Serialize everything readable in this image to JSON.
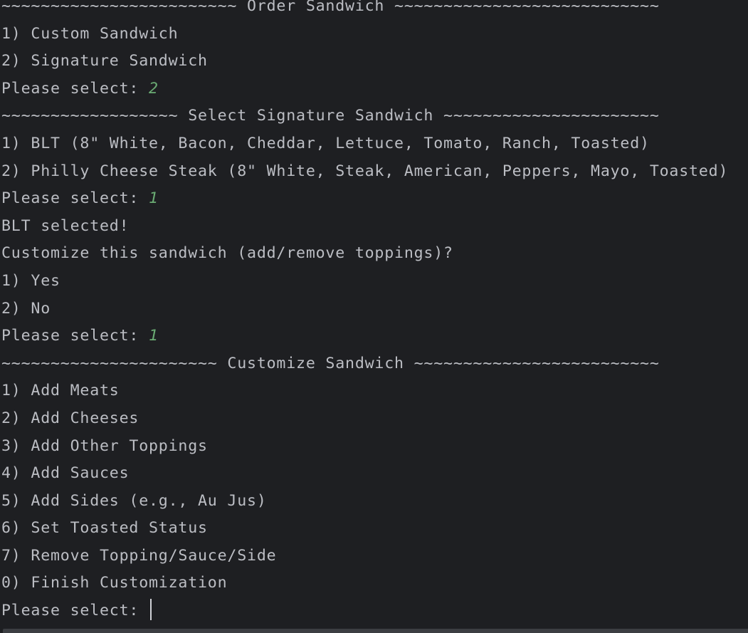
{
  "console": {
    "lines": [
      {
        "text": "~~~~~~~~~~~~~~~~~~~~~~~~ Order Sandwich ~~~~~~~~~~~~~~~~~~~~~~~~~~~",
        "input": null
      },
      {
        "text": "1) Custom Sandwich",
        "input": null
      },
      {
        "text": "2) Signature Sandwich",
        "input": null
      },
      {
        "text": "Please select: ",
        "input": "2"
      },
      {
        "text": "~~~~~~~~~~~~~~~~~~ Select Signature Sandwich ~~~~~~~~~~~~~~~~~~~~~~",
        "input": null
      },
      {
        "text": "1) BLT (8\" White, Bacon, Cheddar, Lettuce, Tomato, Ranch, Toasted)",
        "input": null
      },
      {
        "text": "2) Philly Cheese Steak (8\" White, Steak, American, Peppers, Mayo, Toasted)",
        "input": null
      },
      {
        "text": "Please select: ",
        "input": "1"
      },
      {
        "text": "BLT selected!",
        "input": null
      },
      {
        "text": "Customize this sandwich (add/remove toppings)?",
        "input": null
      },
      {
        "text": "1) Yes",
        "input": null
      },
      {
        "text": "2) No",
        "input": null
      },
      {
        "text": "Please select: ",
        "input": "1"
      },
      {
        "text": "~~~~~~~~~~~~~~~~~~~~~~ Customize Sandwich ~~~~~~~~~~~~~~~~~~~~~~~~~",
        "input": null
      },
      {
        "text": "1) Add Meats",
        "input": null
      },
      {
        "text": "2) Add Cheeses",
        "input": null
      },
      {
        "text": "3) Add Other Toppings",
        "input": null
      },
      {
        "text": "4) Add Sauces",
        "input": null
      },
      {
        "text": "5) Add Sides (e.g., Au Jus)",
        "input": null
      },
      {
        "text": "6) Set Toasted Status",
        "input": null
      },
      {
        "text": "7) Remove Topping/Sauce/Side",
        "input": null
      },
      {
        "text": "0) Finish Customization",
        "input": null
      }
    ],
    "prompt": "Please select: "
  }
}
